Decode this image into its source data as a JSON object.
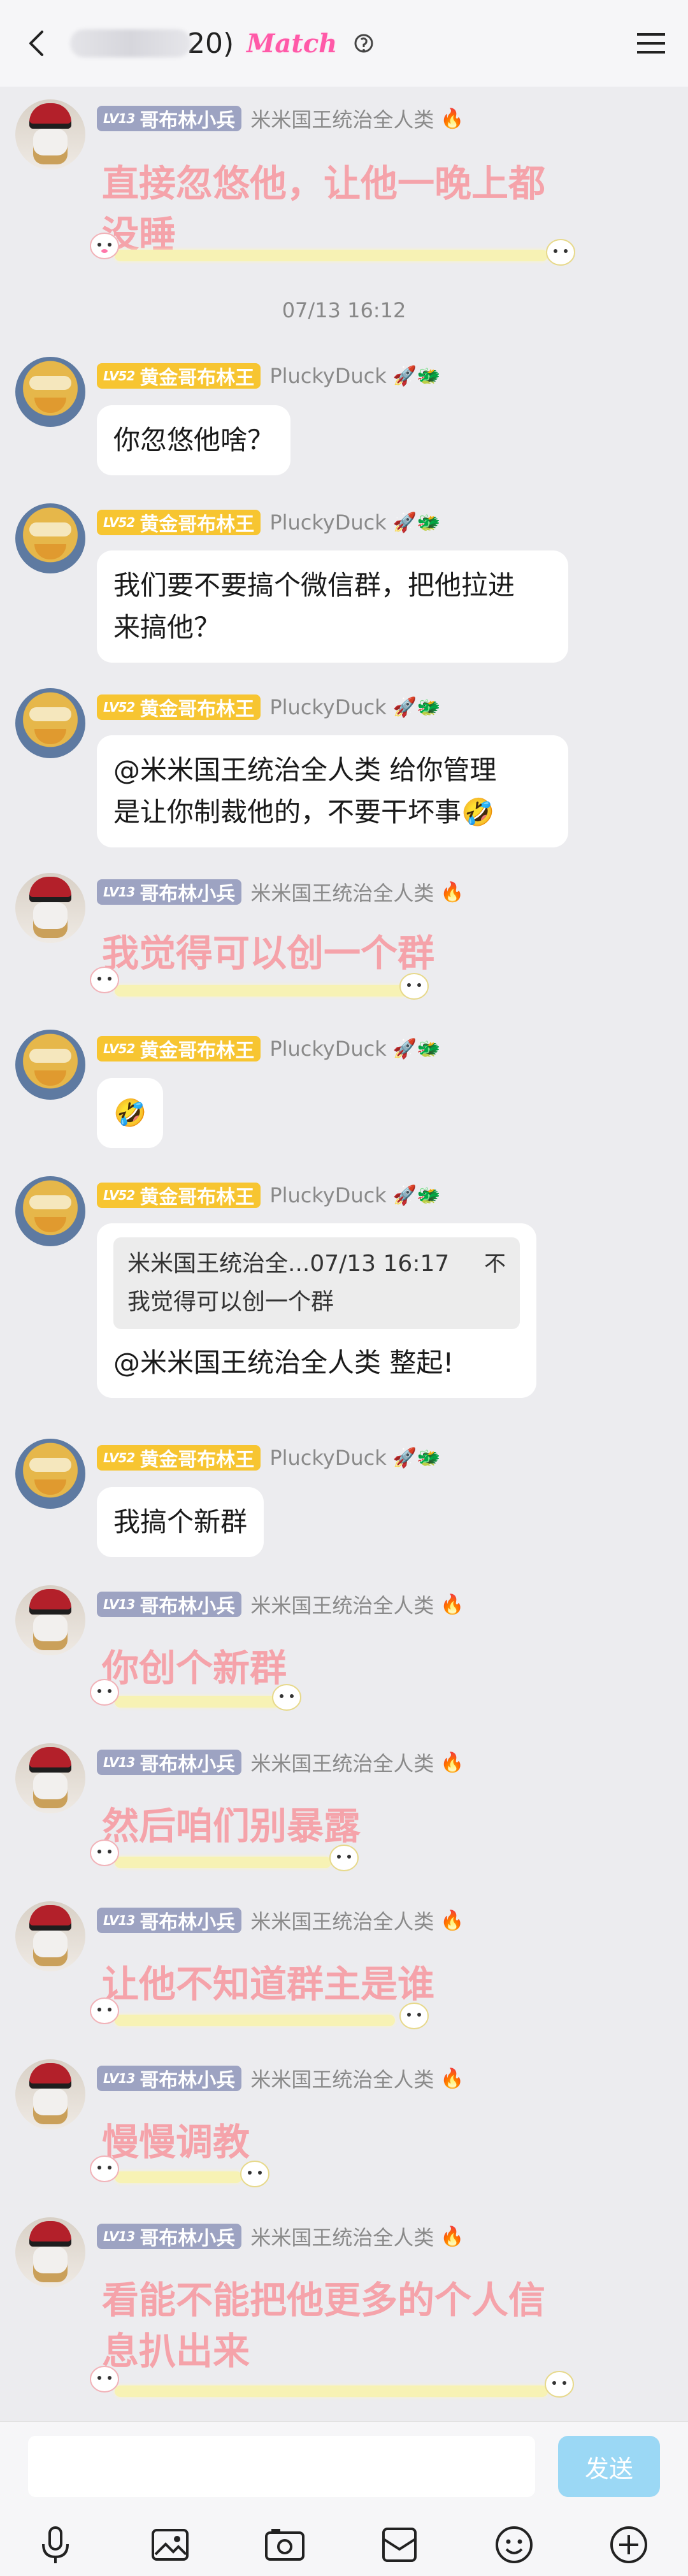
{
  "header": {
    "count": "20)",
    "match_label": "Match",
    "icons": [
      "back-icon",
      "lock-icon",
      "menu-icon"
    ]
  },
  "messages": [
    {
      "type": "danmu",
      "level": "LV13",
      "badge": "哥布林小兵",
      "nickname": "米米国王统治全人类",
      "emoji": "🔥",
      "text": "直接忽悠他，让他一晚上都没睡"
    },
    {
      "type": "time",
      "text": "07/13 16:12"
    },
    {
      "type": "text",
      "level": "LV52",
      "badge": "黄金哥布林王",
      "nickname": "PluckyDuck",
      "emoji": "🚀🐲",
      "text": "你忽悠他啥？"
    },
    {
      "type": "text",
      "level": "LV52",
      "badge": "黄金哥布林王",
      "nickname": "PluckyDuck",
      "emoji": "🚀🐲",
      "line1": "我们要不要搞个微信群，把他拉进",
      "line2": "来搞他？"
    },
    {
      "type": "text",
      "level": "LV52",
      "badge": "黄金哥布林王",
      "nickname": "PluckyDuck",
      "emoji": "🚀🐲",
      "line1": "@米米国王统治全人类 给你管理",
      "line2": "是让你制裁他的，不要干坏事🤣"
    },
    {
      "type": "danmu",
      "level": "LV13",
      "badge": "哥布林小兵",
      "nickname": "米米国王统治全人类",
      "emoji": "🔥",
      "text": "我觉得可以创一个群"
    },
    {
      "type": "text",
      "level": "LV52",
      "badge": "黄金哥布林王",
      "nickname": "PluckyDuck",
      "emoji": "🚀🐲",
      "text": "🤣"
    },
    {
      "type": "quote",
      "level": "LV52",
      "badge": "黄金哥布林王",
      "nickname": "PluckyDuck",
      "emoji": "🚀🐲",
      "quote_head": "米米国王统治全...07/13 16:17",
      "quote_close": "不",
      "quote_text": "我觉得可以创一个群",
      "text": "@米米国王统治全人类 整起!"
    },
    {
      "type": "text",
      "level": "LV52",
      "badge": "黄金哥布林王",
      "nickname": "PluckyDuck",
      "emoji": "🚀🐲",
      "text": "我搞个新群"
    },
    {
      "type": "danmu",
      "level": "LV13",
      "badge": "哥布林小兵",
      "nickname": "米米国王统治全人类",
      "emoji": "🔥",
      "text": "你创个新群"
    },
    {
      "type": "danmu",
      "level": "LV13",
      "badge": "哥布林小兵",
      "nickname": "米米国王统治全人类",
      "emoji": "🔥",
      "text": "然后咱们别暴露"
    },
    {
      "type": "danmu",
      "level": "LV13",
      "badge": "哥布林小兵",
      "nickname": "米米国王统治全人类",
      "emoji": "🔥",
      "text": "让他不知道群主是谁"
    },
    {
      "type": "danmu",
      "level": "LV13",
      "badge": "哥布林小兵",
      "nickname": "米米国王统治全人类",
      "emoji": "🔥",
      "text": "慢慢调教"
    },
    {
      "type": "danmu",
      "level": "LV13",
      "badge": "哥布林小兵",
      "nickname": "米米国王统治全人类",
      "emoji": "🔥",
      "text": "看能不能把他更多的个人信息扒出来"
    }
  ],
  "input": {
    "placeholder": "",
    "send_label": "发送"
  },
  "toolbar": [
    "mic-icon",
    "image-icon",
    "camera-icon",
    "gift-icon",
    "emoji-icon",
    "plus-icon"
  ]
}
